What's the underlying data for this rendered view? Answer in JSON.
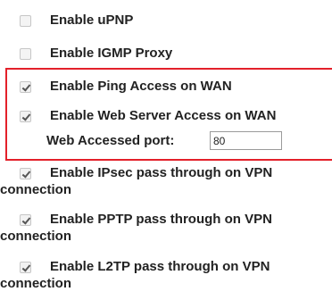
{
  "options": [
    {
      "label": "Enable uPNP",
      "checked": false
    },
    {
      "label": "Enable IGMP Proxy",
      "checked": false
    },
    {
      "label": "Enable Ping Access on WAN",
      "checked": true
    },
    {
      "label": "Enable Web Server Access on WAN",
      "checked": true
    }
  ],
  "web_port": {
    "label": "Web Accessed port:",
    "value": "80"
  },
  "vpn_options": [
    {
      "line1": "Enable IPsec pass through on VPN",
      "line2": "connection",
      "checked": true
    },
    {
      "line1": "Enable PPTP pass through on VPN",
      "line2": "connection",
      "checked": true
    },
    {
      "line1": "Enable L2TP pass through on VPN",
      "line2": "connection",
      "checked": true
    }
  ],
  "colors": {
    "highlight_border": "#e3202a"
  }
}
